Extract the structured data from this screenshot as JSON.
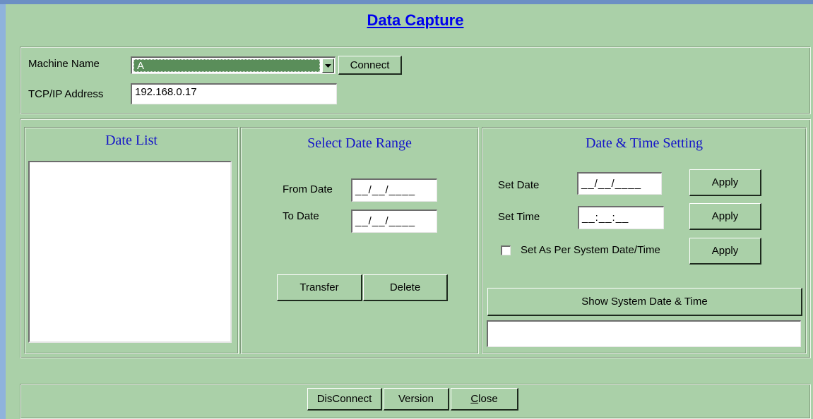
{
  "title": "Data Capture",
  "machine": {
    "name_label": "Machine Name",
    "name_value": "A",
    "connect_label": "Connect",
    "ip_label": "TCP/IP Address",
    "ip_value": "192.168.0.17"
  },
  "date_list": {
    "heading": "Date List"
  },
  "date_range": {
    "heading": "Select Date Range",
    "from_label": "From Date",
    "from_value": "__/__/____",
    "to_label": "To Date",
    "to_value": "__/__/____",
    "transfer_label": "Transfer",
    "delete_label": "Delete"
  },
  "datetime": {
    "heading": "Date & Time Setting",
    "set_date_label": "Set Date",
    "set_date_value": "__/__/____",
    "set_time_label": "Set Time",
    "set_time_value": "__:__:__",
    "apply_label": "Apply",
    "system_checkbox_label": "Set As Per System Date/Time",
    "system_checked": false,
    "show_system_label": "Show System Date & Time",
    "system_output": ""
  },
  "footer": {
    "disconnect_label": "DisConnect",
    "version_label": "Version",
    "close_label": "Close"
  }
}
